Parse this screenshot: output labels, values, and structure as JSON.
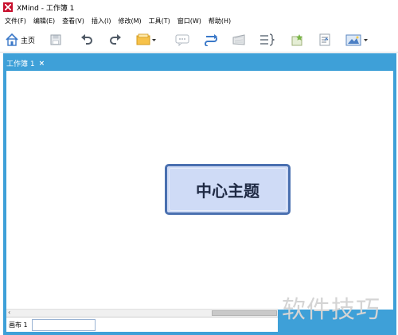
{
  "window": {
    "title": "XMind - 工作簿 1",
    "logo_icon": "xmind-logo-icon"
  },
  "menubar": {
    "items": [
      {
        "label": "文件(F)"
      },
      {
        "label": "编辑(E)"
      },
      {
        "label": "查看(V)"
      },
      {
        "label": "插入(I)"
      },
      {
        "label": "修改(M)"
      },
      {
        "label": "工具(T)"
      },
      {
        "label": "窗口(W)"
      },
      {
        "label": "帮助(H)"
      }
    ]
  },
  "toolbar": {
    "home_label": "主页",
    "icons": [
      "home-icon",
      "save-icon",
      "undo-icon",
      "redo-icon",
      "topic-icon",
      "callout-icon",
      "relationship-icon",
      "boundary-icon",
      "summary-icon",
      "marker-icon",
      "notes-icon",
      "image-icon"
    ]
  },
  "editor": {
    "tab_label": "工作簿 1",
    "tab_close": "×",
    "central_topic": "中心主题",
    "accent_color": "#3ea0d8",
    "topic_fill": "#cfdbf6",
    "topic_border": "#4a70b0"
  },
  "sheets": {
    "active_sheet": "画布 1"
  },
  "scrollbar": {
    "left_arrow": "‹"
  },
  "watermark": "软件技巧"
}
